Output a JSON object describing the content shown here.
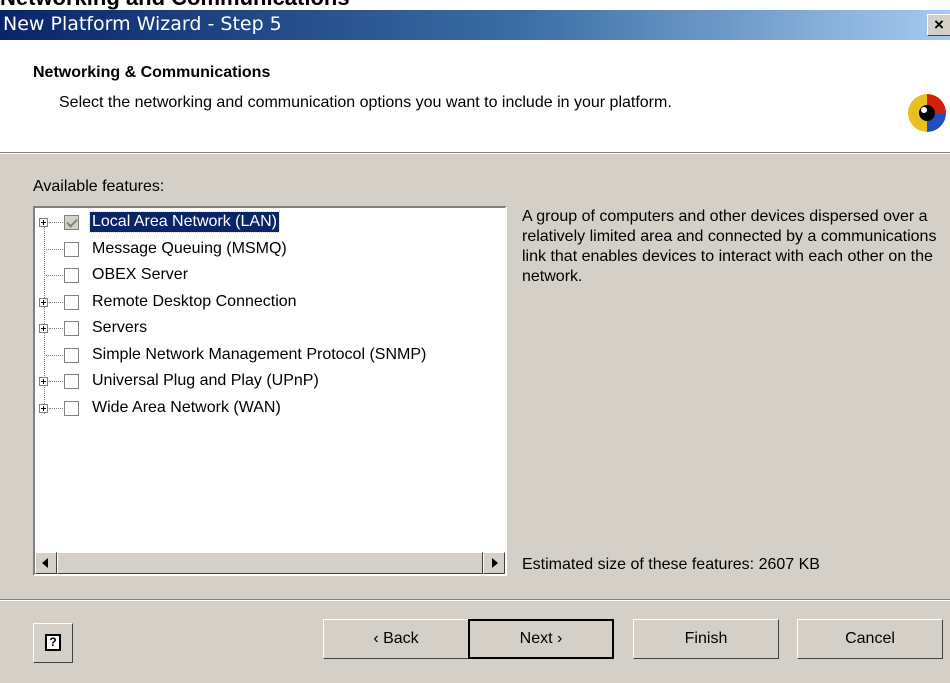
{
  "page_heading": "Networking and Communications",
  "window": {
    "title": "New Platform Wizard - Step 5",
    "close_label": "×"
  },
  "header": {
    "title": "Networking & Communications",
    "description": "Select the networking and communication options you want to include in your platform.",
    "logo_icon": "platform-builder-logo-icon",
    "logo_colors": [
      "#e8c020",
      "#d02010",
      "#2050c0",
      "#000000"
    ]
  },
  "features": {
    "label": "Available features:",
    "items": [
      {
        "label": "Local Area Network (LAN)",
        "expandable": true,
        "checked": true,
        "selected": true
      },
      {
        "label": "Message Queuing (MSMQ)",
        "expandable": false,
        "checked": false,
        "selected": false
      },
      {
        "label": "OBEX Server",
        "expandable": false,
        "checked": false,
        "selected": false
      },
      {
        "label": "Remote Desktop Connection",
        "expandable": true,
        "checked": false,
        "selected": false
      },
      {
        "label": "Servers",
        "expandable": true,
        "checked": false,
        "selected": false
      },
      {
        "label": "Simple Network Management Protocol (SNMP)",
        "expandable": false,
        "checked": false,
        "selected": false
      },
      {
        "label": "Universal Plug and Play (UPnP)",
        "expandable": true,
        "checked": false,
        "selected": false
      },
      {
        "label": "Wide Area Network (WAN)",
        "expandable": true,
        "checked": false,
        "selected": false
      }
    ]
  },
  "description_text": "A group of computers and other devices dispersed over a relatively limited area and connected by a communications link that enables devices to interact with each other on the network.",
  "estimated_size": "Estimated size of these features: 2607 KB",
  "buttons": {
    "help_glyph": "?",
    "back": "‹ Back",
    "next": "Next ›",
    "finish": "Finish",
    "cancel": "Cancel"
  },
  "colors": {
    "titlebar_start": "#0a246a",
    "titlebar_end": "#a6caf0",
    "dialog_face": "#d4d0c8",
    "selection": "#0a246a"
  }
}
